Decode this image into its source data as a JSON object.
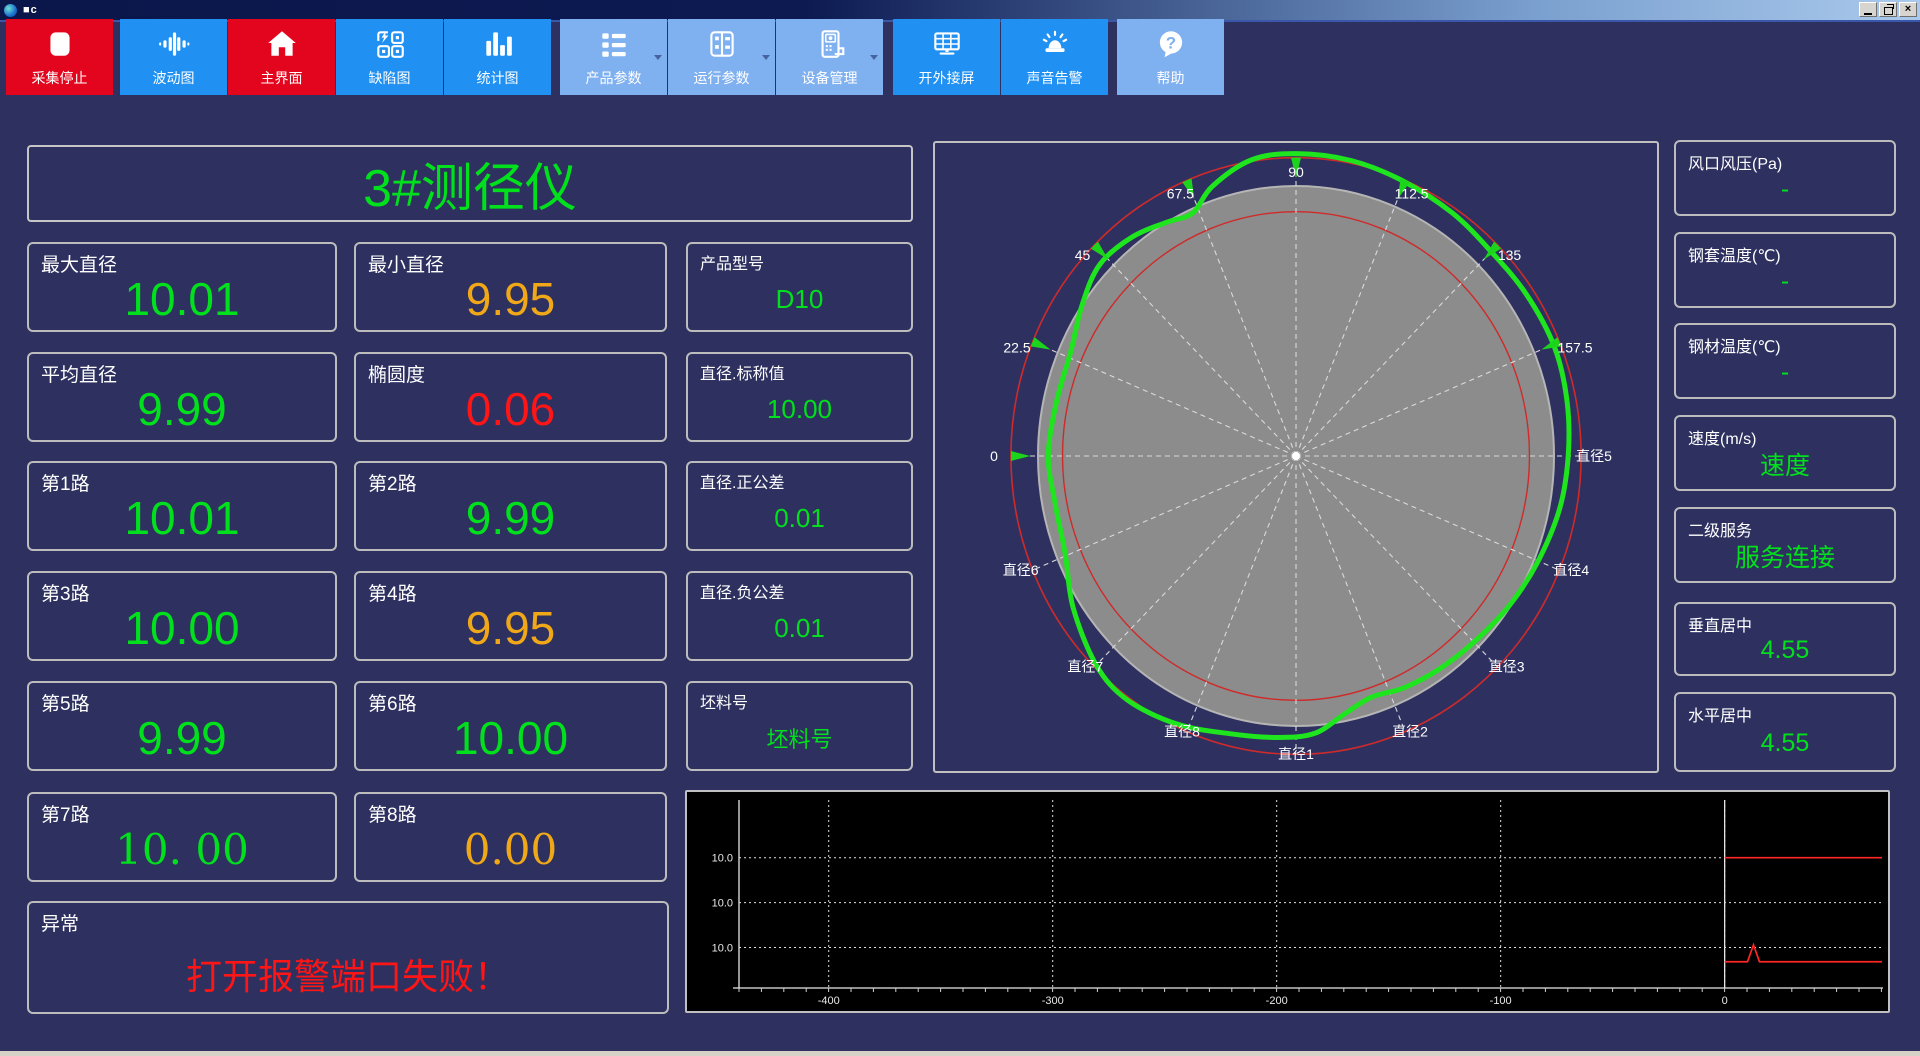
{
  "window": {
    "title": "■c"
  },
  "toolbar": {
    "buttons": [
      {
        "label": "采集停止",
        "icon": "stop-icon",
        "style": "red"
      },
      {
        "label": "波动图",
        "icon": "waveform-icon",
        "style": "blue"
      },
      {
        "label": "主界面",
        "icon": "home-icon",
        "style": "red"
      },
      {
        "label": "缺陷图",
        "icon": "defect-map-icon",
        "style": "blue"
      },
      {
        "label": "统计图",
        "icon": "bar-chart-icon",
        "style": "blue"
      },
      {
        "label": "产品参数",
        "icon": "product-params-icon",
        "style": "light",
        "dropdown": true
      },
      {
        "label": "运行参数",
        "icon": "run-params-icon",
        "style": "light",
        "dropdown": true
      },
      {
        "label": "设备管理",
        "icon": "device-manage-icon",
        "style": "light",
        "dropdown": true
      },
      {
        "label": "开外接屏",
        "icon": "external-screen-icon",
        "style": "blue"
      },
      {
        "label": "声音告警",
        "icon": "sound-alarm-icon",
        "style": "blue"
      },
      {
        "label": "帮助",
        "icon": "help-icon",
        "style": "light"
      }
    ]
  },
  "panel_title": "3#测径仪",
  "left_cards": [
    {
      "label": "最大直径",
      "value": "10.01",
      "color": "green"
    },
    {
      "label": "最小直径",
      "value": "9.95",
      "color": "orange"
    },
    {
      "label": "产品型号",
      "value": "D10",
      "color": "green"
    },
    {
      "label": "平均直径",
      "value": "9.99",
      "color": "green"
    },
    {
      "label": "椭圆度",
      "value": "0.06",
      "color": "red"
    },
    {
      "label": "直径.标称值",
      "value": "10.00",
      "color": "green"
    },
    {
      "label": "第1路",
      "value": "10.01",
      "color": "green"
    },
    {
      "label": "第2路",
      "value": "9.99",
      "color": "green"
    },
    {
      "label": "直径.正公差",
      "value": "0.01",
      "color": "green"
    },
    {
      "label": "第3路",
      "value": "10.00",
      "color": "green"
    },
    {
      "label": "第4路",
      "value": "9.95",
      "color": "orange"
    },
    {
      "label": "直径.负公差",
      "value": "0.01",
      "color": "green"
    },
    {
      "label": "第5路",
      "value": "9.99",
      "color": "green"
    },
    {
      "label": "第6路",
      "value": "10.00",
      "color": "green"
    },
    {
      "label": "坯料号",
      "value": "坯料号",
      "color": "green"
    },
    {
      "label": "第7路",
      "value": "10. 00",
      "color": "green"
    },
    {
      "label": "第8路",
      "value": "0.00",
      "color": "orange"
    }
  ],
  "exception_card": {
    "label": "异常",
    "value": "打开报警端口失败！"
  },
  "right_cards": [
    {
      "label": "风口风压(Pa)",
      "value": "-"
    },
    {
      "label": "钢套温度(℃)",
      "value": "-"
    },
    {
      "label": "钢材温度(℃)",
      "value": "-"
    },
    {
      "label": "速度(m/s)",
      "value": "速度"
    },
    {
      "label": "二级服务",
      "value": "服务连接"
    },
    {
      "label": "垂直居中",
      "value": "4.55"
    },
    {
      "label": "水平居中",
      "value": "4.55"
    }
  ],
  "colors": {
    "background": "#2e3160",
    "value_green": "#00e01c",
    "value_orange": "#f0a818",
    "value_red": "#ff1515",
    "button_red": "#e3051d",
    "button_blue": "#2090f2",
    "button_light": "#7fb0f0",
    "curve_green": "#1ee51e",
    "ring_red": "#cf2a2a",
    "ring_gray": "#8c8c8c"
  },
  "chart_data": {
    "polar_chart": {
      "type": "polar-profile",
      "spoke_step_deg": 22.5,
      "angle_labels": [
        {
          "text": "0",
          "deg": 180
        },
        {
          "text": "22.5",
          "deg": 157.5
        },
        {
          "text": "45",
          "deg": 135
        },
        {
          "text": "67.5",
          "deg": 112.5
        },
        {
          "text": "90",
          "deg": 90
        },
        {
          "text": "112.5",
          "deg": 67.5
        },
        {
          "text": "135",
          "deg": 45
        },
        {
          "text": "157.5",
          "deg": 22.5
        }
      ],
      "diameter_labels": [
        {
          "text": "直径1",
          "deg": 270
        },
        {
          "text": "直径2",
          "deg": 292.5
        },
        {
          "text": "直径3",
          "deg": 315
        },
        {
          "text": "直径4",
          "deg": 337.5
        },
        {
          "text": "直径5",
          "deg": 0
        },
        {
          "text": "直径6",
          "deg": 202.5
        },
        {
          "text": "直径7",
          "deg": 225
        },
        {
          "text": "直径8",
          "deg": 247.5
        }
      ],
      "rings": {
        "gray_scale": 1.0,
        "red_outer_scale": 1.105,
        "red_inner_scale": 0.905
      },
      "profile_scale_points": [
        [
          0,
          1.055
        ],
        [
          11,
          1.07
        ],
        [
          22,
          1.08
        ],
        [
          34,
          1.075
        ],
        [
          45,
          1.07
        ],
        [
          56,
          1.085
        ],
        [
          68,
          1.1
        ],
        [
          79,
          1.115
        ],
        [
          90,
          1.12
        ],
        [
          99,
          1.11
        ],
        [
          108,
          1.05
        ],
        [
          114,
          0.985
        ],
        [
          120,
          1.0
        ],
        [
          128,
          1.03
        ],
        [
          137,
          1.04
        ],
        [
          146,
          1.0
        ],
        [
          156,
          0.955
        ],
        [
          168,
          0.95
        ],
        [
          180,
          0.96
        ],
        [
          191,
          0.95
        ],
        [
          202,
          0.965
        ],
        [
          213,
          1.03
        ],
        [
          225,
          1.095
        ],
        [
          234,
          1.115
        ],
        [
          245,
          1.095
        ],
        [
          256,
          1.06
        ],
        [
          266,
          1.045
        ],
        [
          274,
          1.03
        ],
        [
          281,
          0.975
        ],
        [
          288,
          0.94
        ],
        [
          296,
          0.955
        ],
        [
          305,
          0.965
        ],
        [
          315,
          0.975
        ],
        [
          326,
          0.995
        ],
        [
          337,
          1.015
        ],
        [
          349,
          1.04
        ]
      ]
    },
    "trend_chart": {
      "type": "line",
      "y_tick_labels": [
        "10.0",
        "10.0",
        "10.0"
      ],
      "x_tick_labels": [
        "-400",
        "-300",
        "-200",
        "-100",
        "0"
      ],
      "grid_fy": [
        0.3,
        0.505,
        0.71
      ],
      "tick_fx": [
        0.118,
        0.3045,
        0.491,
        0.6775,
        0.864
      ],
      "zero_line_fx": 0.864,
      "series": [
        {
          "name": "upper-limit-line",
          "color": "#ff2626",
          "fy": 0.3,
          "from_fx": 0.864,
          "to_fx": 0.995
        },
        {
          "name": "measured-line",
          "color": "#ff2626",
          "fy": 0.775,
          "from_fx": 0.864,
          "to_fx": 0.995,
          "spike_fx": 0.888,
          "spike_fy": 0.698
        }
      ]
    }
  }
}
